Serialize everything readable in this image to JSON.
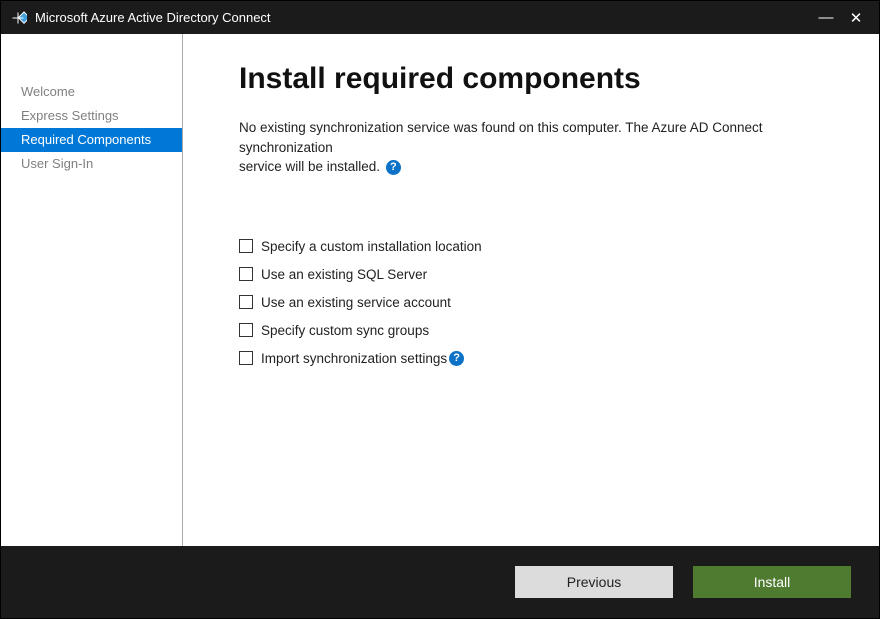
{
  "titlebar": {
    "title": "Microsoft Azure Active Directory Connect"
  },
  "sidebar": {
    "items": [
      {
        "label": "Welcome",
        "active": false
      },
      {
        "label": "Express Settings",
        "active": false
      },
      {
        "label": "Required Components",
        "active": true
      },
      {
        "label": "User Sign-In",
        "active": false
      }
    ]
  },
  "main": {
    "title": "Install required components",
    "description_l1": "No existing synchronization service was found on this computer. The Azure AD Connect synchronization",
    "description_l2": "service will be installed.",
    "options": [
      {
        "label": "Specify a custom installation location",
        "help": false
      },
      {
        "label": "Use an existing SQL Server",
        "help": false
      },
      {
        "label": "Use an existing service account",
        "help": false
      },
      {
        "label": "Specify custom sync groups",
        "help": false
      },
      {
        "label": "Import synchronization settings",
        "help": true
      }
    ]
  },
  "footer": {
    "previous": "Previous",
    "install": "Install"
  },
  "glyphs": {
    "help": "?",
    "minimize": "—",
    "close": "✕"
  }
}
